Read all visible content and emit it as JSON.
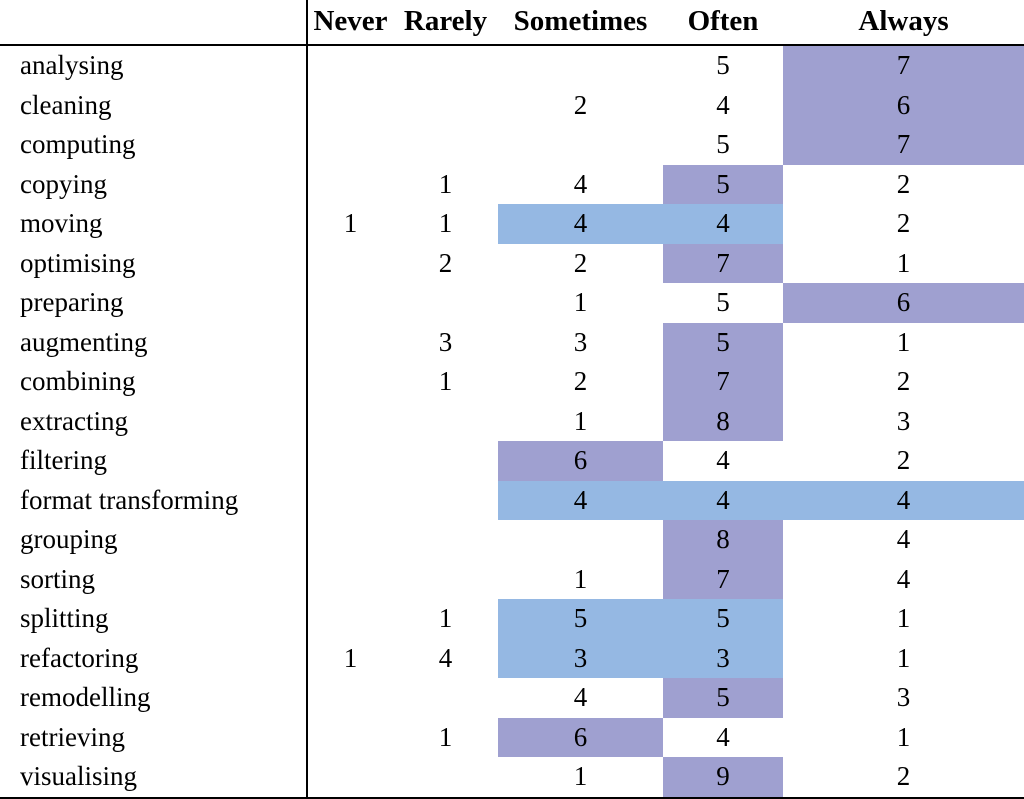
{
  "table": {
    "columns": [
      "",
      "Never",
      "Rarely",
      "Sometimes",
      "Often",
      "Always"
    ],
    "headers": {
      "label": "",
      "never": "Never",
      "rarely": "Rarely",
      "sometimes": "Sometimes",
      "often": "Often",
      "always": "Always"
    },
    "colors": {
      "purple": "#9fa0d0",
      "blue": "#95b8e3",
      "text": "#000000",
      "rule": "#000000",
      "background": "#ffffff"
    },
    "rows": [
      {
        "label": "analysing",
        "never": "",
        "rarely": "",
        "sometimes": "",
        "often": "5",
        "always": "7",
        "hl": {
          "never": "",
          "rarely": "",
          "sometimes": "",
          "often": "",
          "always": "purple"
        }
      },
      {
        "label": "cleaning",
        "never": "",
        "rarely": "",
        "sometimes": "2",
        "often": "4",
        "always": "6",
        "hl": {
          "never": "",
          "rarely": "",
          "sometimes": "",
          "often": "",
          "always": "purple"
        }
      },
      {
        "label": "computing",
        "never": "",
        "rarely": "",
        "sometimes": "",
        "often": "5",
        "always": "7",
        "hl": {
          "never": "",
          "rarely": "",
          "sometimes": "",
          "often": "",
          "always": "purple"
        }
      },
      {
        "label": "copying",
        "never": "",
        "rarely": "1",
        "sometimes": "4",
        "often": "5",
        "always": "2",
        "hl": {
          "never": "",
          "rarely": "",
          "sometimes": "",
          "often": "purple",
          "always": ""
        }
      },
      {
        "label": "moving",
        "never": "1",
        "rarely": "1",
        "sometimes": "4",
        "often": "4",
        "always": "2",
        "hl": {
          "never": "",
          "rarely": "",
          "sometimes": "blue",
          "often": "blue",
          "always": ""
        }
      },
      {
        "label": "optimising",
        "never": "",
        "rarely": "2",
        "sometimes": "2",
        "often": "7",
        "always": "1",
        "hl": {
          "never": "",
          "rarely": "",
          "sometimes": "",
          "often": "purple",
          "always": ""
        }
      },
      {
        "label": "preparing",
        "never": "",
        "rarely": "",
        "sometimes": "1",
        "often": "5",
        "always": "6",
        "hl": {
          "never": "",
          "rarely": "",
          "sometimes": "",
          "often": "",
          "always": "purple"
        }
      },
      {
        "label": "augmenting",
        "never": "",
        "rarely": "3",
        "sometimes": "3",
        "often": "5",
        "always": "1",
        "hl": {
          "never": "",
          "rarely": "",
          "sometimes": "",
          "often": "purple",
          "always": ""
        }
      },
      {
        "label": "combining",
        "never": "",
        "rarely": "1",
        "sometimes": "2",
        "often": "7",
        "always": "2",
        "hl": {
          "never": "",
          "rarely": "",
          "sometimes": "",
          "often": "purple",
          "always": ""
        }
      },
      {
        "label": "extracting",
        "never": "",
        "rarely": "",
        "sometimes": "1",
        "often": "8",
        "always": "3",
        "hl": {
          "never": "",
          "rarely": "",
          "sometimes": "",
          "often": "purple",
          "always": ""
        }
      },
      {
        "label": "filtering",
        "never": "",
        "rarely": "",
        "sometimes": "6",
        "often": "4",
        "always": "2",
        "hl": {
          "never": "",
          "rarely": "",
          "sometimes": "purple",
          "often": "",
          "always": ""
        }
      },
      {
        "label": "format transforming",
        "never": "",
        "rarely": "",
        "sometimes": "4",
        "often": "4",
        "always": "4",
        "hl": {
          "never": "",
          "rarely": "",
          "sometimes": "blue",
          "often": "blue",
          "always": "blue"
        }
      },
      {
        "label": "grouping",
        "never": "",
        "rarely": "",
        "sometimes": "",
        "often": "8",
        "always": "4",
        "hl": {
          "never": "",
          "rarely": "",
          "sometimes": "",
          "often": "purple",
          "always": ""
        }
      },
      {
        "label": "sorting",
        "never": "",
        "rarely": "",
        "sometimes": "1",
        "often": "7",
        "always": "4",
        "hl": {
          "never": "",
          "rarely": "",
          "sometimes": "",
          "often": "purple",
          "always": ""
        }
      },
      {
        "label": "splitting",
        "never": "",
        "rarely": "1",
        "sometimes": "5",
        "often": "5",
        "always": "1",
        "hl": {
          "never": "",
          "rarely": "",
          "sometimes": "blue",
          "often": "blue",
          "always": ""
        }
      },
      {
        "label": "refactoring",
        "never": "1",
        "rarely": "4",
        "sometimes": "3",
        "often": "3",
        "always": "1",
        "hl": {
          "never": "",
          "rarely": "",
          "sometimes": "blue",
          "often": "blue",
          "always": ""
        }
      },
      {
        "label": "remodelling",
        "never": "",
        "rarely": "",
        "sometimes": "4",
        "often": "5",
        "always": "3",
        "hl": {
          "never": "",
          "rarely": "",
          "sometimes": "",
          "often": "purple",
          "always": ""
        }
      },
      {
        "label": "retrieving",
        "never": "",
        "rarely": "1",
        "sometimes": "6",
        "often": "4",
        "always": "1",
        "hl": {
          "never": "",
          "rarely": "",
          "sometimes": "purple",
          "often": "",
          "always": ""
        }
      },
      {
        "label": "visualising",
        "never": "",
        "rarely": "",
        "sometimes": "1",
        "often": "9",
        "always": "2",
        "hl": {
          "never": "",
          "rarely": "",
          "sometimes": "",
          "often": "purple",
          "always": ""
        }
      }
    ]
  },
  "chart_data": {
    "type": "table",
    "title": "",
    "categories": [
      "Never",
      "Rarely",
      "Sometimes",
      "Often",
      "Always"
    ],
    "series": [
      {
        "name": "analysing",
        "values": [
          0,
          0,
          0,
          5,
          7
        ]
      },
      {
        "name": "cleaning",
        "values": [
          0,
          0,
          2,
          4,
          6
        ]
      },
      {
        "name": "computing",
        "values": [
          0,
          0,
          0,
          5,
          7
        ]
      },
      {
        "name": "copying",
        "values": [
          0,
          1,
          4,
          5,
          2
        ]
      },
      {
        "name": "moving",
        "values": [
          1,
          1,
          4,
          4,
          2
        ]
      },
      {
        "name": "optimising",
        "values": [
          0,
          2,
          2,
          7,
          1
        ]
      },
      {
        "name": "preparing",
        "values": [
          0,
          0,
          1,
          5,
          6
        ]
      },
      {
        "name": "augmenting",
        "values": [
          0,
          3,
          3,
          5,
          1
        ]
      },
      {
        "name": "combining",
        "values": [
          0,
          1,
          2,
          7,
          2
        ]
      },
      {
        "name": "extracting",
        "values": [
          0,
          0,
          1,
          8,
          3
        ]
      },
      {
        "name": "filtering",
        "values": [
          0,
          0,
          6,
          4,
          2
        ]
      },
      {
        "name": "format transforming",
        "values": [
          0,
          0,
          4,
          4,
          4
        ]
      },
      {
        "name": "grouping",
        "values": [
          0,
          0,
          0,
          8,
          4
        ]
      },
      {
        "name": "sorting",
        "values": [
          0,
          0,
          1,
          7,
          4
        ]
      },
      {
        "name": "splitting",
        "values": [
          0,
          1,
          5,
          5,
          1
        ]
      },
      {
        "name": "refactoring",
        "values": [
          1,
          4,
          3,
          3,
          1
        ]
      },
      {
        "name": "remodelling",
        "values": [
          0,
          0,
          4,
          5,
          3
        ]
      },
      {
        "name": "retrieving",
        "values": [
          0,
          1,
          6,
          4,
          1
        ]
      },
      {
        "name": "visualising",
        "values": [
          0,
          0,
          1,
          9,
          2
        ]
      }
    ],
    "xlabel": "",
    "ylabel": "",
    "grid": false,
    "legend": "none",
    "highlight_legend": [
      {
        "color": "#9fa0d0",
        "meaning": "purple-highlight"
      },
      {
        "color": "#95b8e3",
        "meaning": "blue-highlight"
      }
    ]
  }
}
